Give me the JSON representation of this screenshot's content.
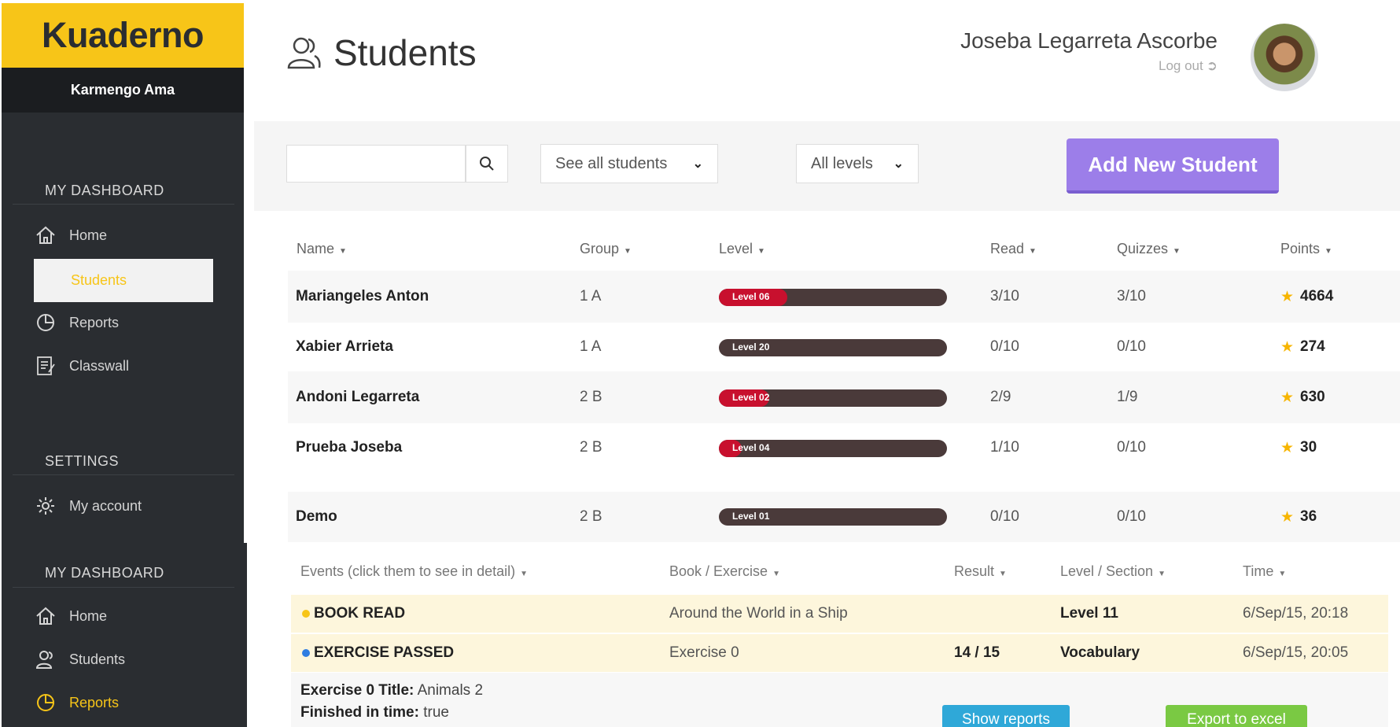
{
  "app": {
    "logo": "Kuaderno",
    "school": "Karmengo Ama"
  },
  "sidebar": {
    "dashboard_heading": "MY DASHBOARD",
    "settings_heading": "SETTINGS",
    "items": [
      {
        "label": "Home",
        "icon": "home-icon"
      },
      {
        "label": "Students",
        "icon": "students-icon",
        "active": true
      },
      {
        "label": "Reports",
        "icon": "reports-icon"
      },
      {
        "label": "Classwall",
        "icon": "classwall-icon"
      }
    ],
    "settings_items": [
      {
        "label": "My account",
        "icon": "gear-icon"
      }
    ]
  },
  "sidebar2": {
    "dashboard_heading": "MY DASHBOARD",
    "items": [
      {
        "label": "Home",
        "icon": "home-icon"
      },
      {
        "label": "Students",
        "icon": "students-icon"
      },
      {
        "label": "Reports",
        "icon": "reports-icon",
        "active": true
      }
    ]
  },
  "header": {
    "title": "Students",
    "user_name": "Joseba Legarreta Ascorbe",
    "logout_label": "Log out"
  },
  "filters": {
    "search_placeholder": "",
    "group_select": "See all students",
    "level_select": "All levels",
    "add_button": "Add New Student"
  },
  "table": {
    "headers": {
      "name": "Name",
      "group": "Group",
      "level": "Level",
      "read": "Read",
      "quizzes": "Quizzes",
      "points": "Points"
    },
    "rows": [
      {
        "name": "Mariangeles Anton",
        "group": "1 A",
        "level": "Level 06",
        "level_fill": 0.3,
        "read": "3/10",
        "quizzes": "3/10",
        "points": "4664"
      },
      {
        "name": "Xabier Arrieta",
        "group": "1 A",
        "level": "Level 20",
        "level_fill": 0.0,
        "read": "0/10",
        "quizzes": "0/10",
        "points": "274"
      },
      {
        "name": "Andoni Legarreta",
        "group": "2 B",
        "level": "Level 02",
        "level_fill": 0.22,
        "read": "2/9",
        "quizzes": "1/9",
        "points": "630"
      },
      {
        "name": "Prueba Joseba",
        "group": "2 B",
        "level": "Level 04",
        "level_fill": 0.1,
        "read": "1/10",
        "quizzes": "0/10",
        "points": "30"
      },
      {
        "name": "Demo",
        "group": "2 B",
        "level": "Level 01",
        "level_fill": 0.0,
        "read": "0/10",
        "quizzes": "0/10",
        "points": "36"
      }
    ]
  },
  "events": {
    "headers": {
      "event": "Events (click them to see in detail)",
      "book": "Book / Exercise",
      "result": "Result",
      "level": "Level / Section",
      "time": "Time"
    },
    "rows": [
      {
        "type": "BOOK READ",
        "dot_color": "#f7c518",
        "book": "Around the World in a Ship",
        "result": "",
        "level": "Level 11",
        "time": "6/Sep/15, 20:18"
      },
      {
        "type": "EXERCISE PASSED",
        "dot_color": "#2f7de1",
        "book": "Exercise 0",
        "result": "14 / 15",
        "level": "Vocabulary",
        "time": "6/Sep/15, 20:05"
      }
    ],
    "detail": {
      "title_label": "Exercise 0 Title:",
      "title_value": "Animals 2",
      "finished_label": "Finished in time:",
      "finished_value": "true"
    },
    "show_reports": "Show reports",
    "export_excel": "Export to excel"
  },
  "colors": {
    "brand": "#f7c518",
    "sidebar": "#2a2d31",
    "add_button": "#9c7ee9",
    "level_bar": "#4a3a3a",
    "level_fill": "#c8102e"
  }
}
